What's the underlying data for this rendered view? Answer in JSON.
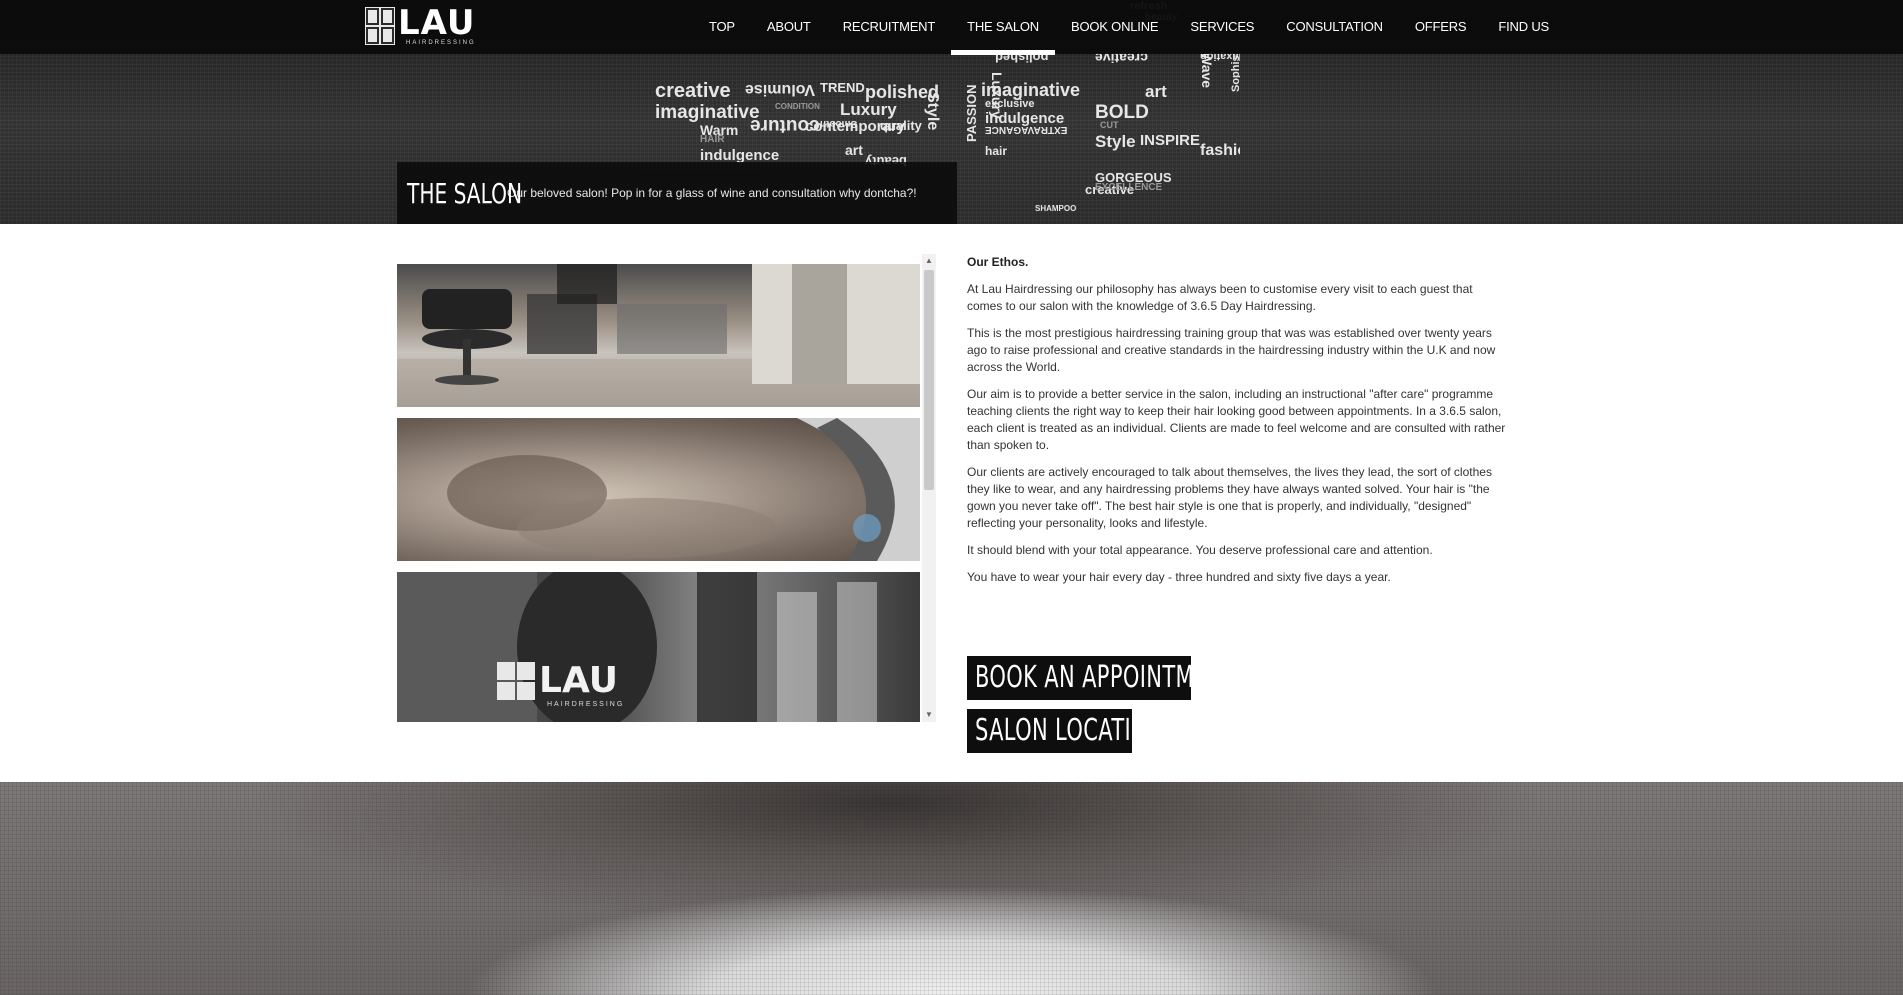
{
  "brand": {
    "logo_text": "LAU",
    "logo_sub": "HAIRDRESSING"
  },
  "nav": {
    "items": [
      {
        "label": "TOP"
      },
      {
        "label": "ABOUT"
      },
      {
        "label": "RECRUITMENT"
      },
      {
        "label": "THE SALON",
        "active": true
      },
      {
        "label": "BOOK ONLINE"
      },
      {
        "label": "SERVICES"
      },
      {
        "label": "CONSULTATION"
      },
      {
        "label": "OFFERS"
      },
      {
        "label": "FIND US"
      }
    ]
  },
  "wordcloud": [
    "creative",
    "Volumise",
    "TREND",
    "polished",
    "imaginative",
    "CONDITION",
    "Luxury",
    "contemporary",
    "Style",
    "Warm",
    "HAIR",
    "couture",
    "Smooth",
    "quality",
    "indulgence",
    "art",
    "beauty",
    "PASSION",
    "imaginative",
    "exclusive",
    "indulgence",
    "BOLD",
    "EXTRAVAGANCE",
    "hair",
    "CUT",
    "Style",
    "INSPIRE",
    "fashion",
    "GORGEOUS",
    "creative",
    "EXCELLENCE",
    "Sophis",
    "art",
    "Wave",
    "ORIGINAL",
    "polished",
    "creative",
    "Relaxation",
    "refresh",
    "beauty",
    "SHAMPOO",
    "Luxury"
  ],
  "hero": {
    "title": "THE SALON",
    "subtitle": "Our beloved salon! Pop in for a glass of wine and consultation why dontcha?!"
  },
  "article": {
    "heading": "Our Ethos.",
    "paragraphs": [
      "At Lau Hairdressing our philosophy has always been to customise every visit to each guest that comes to our salon with the knowledge of 3.6.5 Day Hairdressing.",
      "This is the most prestigious hairdressing training group that was was established over twenty years ago to raise professional and creative standards in the hairdressing industry within the U.K and now across the World.",
      "Our aim is to provide a better service in the salon, including an instructional \"after care\" programme teaching clients the right way to keep their hair looking good between appointments. In a 3.6.5 salon, each client is treated as an individual. Clients are made to feel welcome and are consulted with rather than spoken to.",
      "Our clients are actively encouraged to talk about themselves, the lives they lead, the sort of clothes they like to wear, and any hairdressing problems they have always wanted solved. Your hair is \"the gown you never take off\". The best hair style is one that is properly, and individually, \"designed\" reflecting your personality, looks and lifestyle.",
      "It should blend with your total appearance. You deserve professional care and attention.",
      "You have to wear your hair every day - three hundred and sixty five days a year."
    ]
  },
  "buttons": {
    "book": "BOOK AN APPOINTMENT",
    "location": "SALON LOCATION"
  },
  "gallery": {
    "photo3_brand": "LAU",
    "photo3_sub": "HAIRDRESSING"
  },
  "scrollbar": {
    "up": "▲",
    "down": "▼"
  }
}
